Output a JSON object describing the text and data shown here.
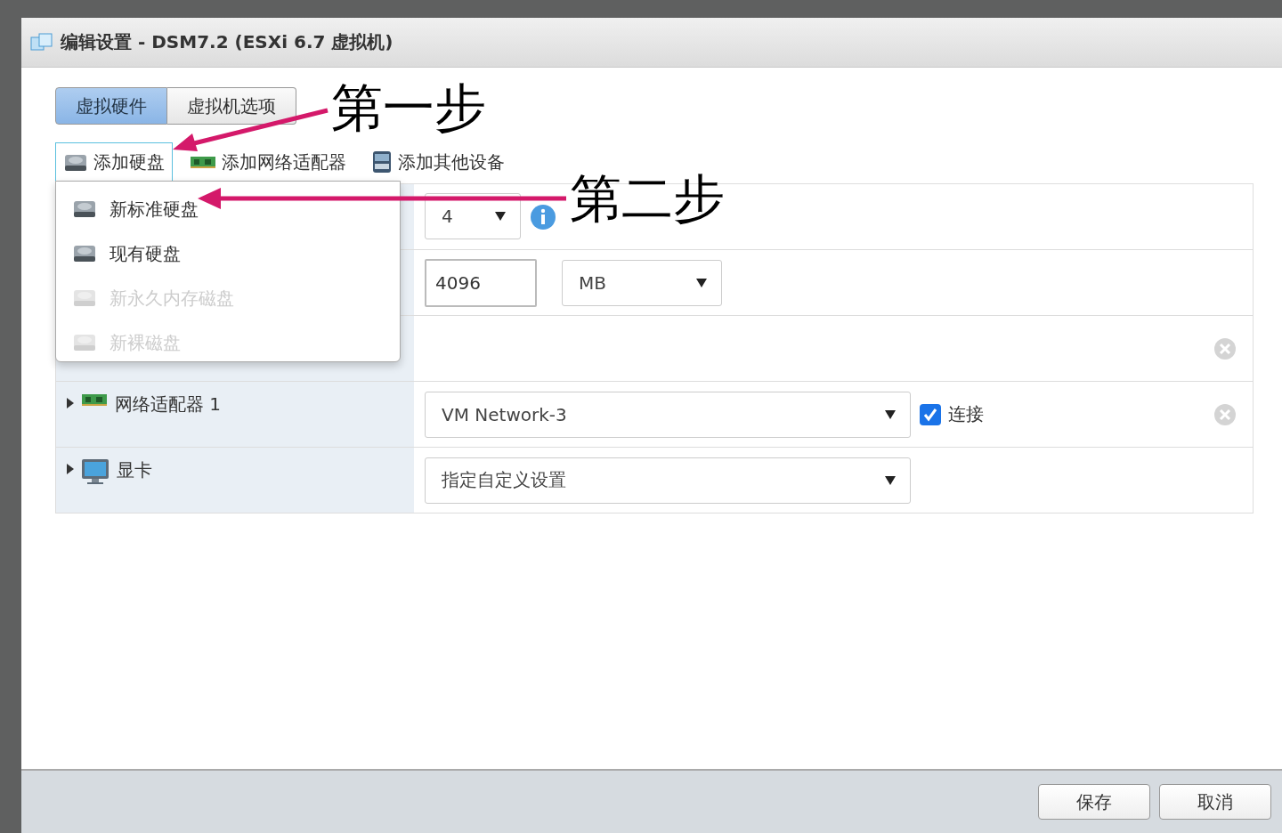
{
  "window": {
    "title": "编辑设置 - DSM7.2 (ESXi 6.7 虚拟机)"
  },
  "tabs": [
    {
      "label": "虚拟硬件",
      "selected": true
    },
    {
      "label": "虚拟机选项",
      "selected": false
    }
  ],
  "toolbar": [
    {
      "label": "添加硬盘",
      "kind": "disk",
      "selected": true
    },
    {
      "label": "添加网络适配器",
      "kind": "nic",
      "selected": false
    },
    {
      "label": "添加其他设备",
      "kind": "device",
      "selected": false
    }
  ],
  "menu": [
    {
      "label": "新标准硬盘",
      "disabled": false
    },
    {
      "label": "现有硬盘",
      "disabled": false
    },
    {
      "label": "新永久内存磁盘",
      "disabled": true
    },
    {
      "label": "新裸磁盘",
      "disabled": true
    }
  ],
  "rows": [
    {
      "kind": "cpu",
      "select": "4",
      "removable": false
    },
    {
      "kind": "memory",
      "value": "4096",
      "unit": "MB",
      "removable": false
    },
    {
      "kind": "empty",
      "removable": true
    },
    {
      "kind": "network",
      "label": "网络适配器 1",
      "select": "VM Network-3",
      "connect": {
        "label": "连接",
        "checked": true
      },
      "removable": true
    },
    {
      "kind": "video",
      "label": "显卡",
      "select": "指定自定义设置",
      "removable": false
    }
  ],
  "annotations": [
    {
      "text": "第一步"
    },
    {
      "text": "第二步"
    }
  ],
  "buttons": [
    "保存",
    "取消"
  ]
}
